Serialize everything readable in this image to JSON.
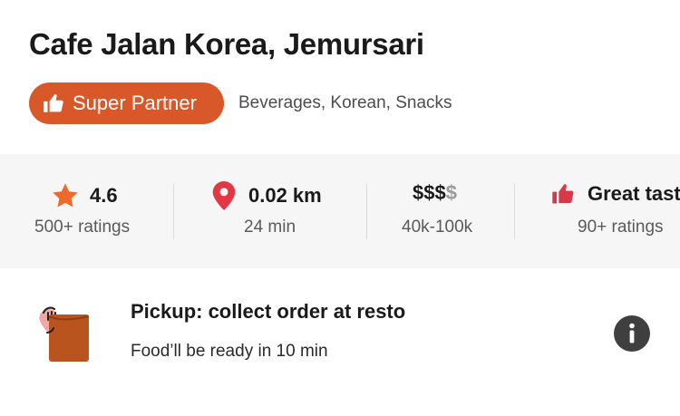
{
  "header": {
    "title": "Cafe Jalan Korea, Jemursari",
    "badge_label": "Super Partner",
    "cuisines": "Beverages, Korean, Snacks"
  },
  "stats": {
    "rating": {
      "value": "4.6",
      "caption": "500+ ratings",
      "icon": "star-icon"
    },
    "distance": {
      "value": "0.02 km",
      "caption": "24 min",
      "icon": "map-pin-icon"
    },
    "price": {
      "value_active": "$$$",
      "value_inactive": "$",
      "caption": "40k-100k"
    },
    "taste": {
      "value": "Great tast",
      "caption": "90+ ratings",
      "icon": "thumbs-up-icon"
    }
  },
  "pickup": {
    "title": "Pickup: collect order at resto",
    "subtitle": "Food’ll be ready in 10 min",
    "icon": "pickup-bag-icon",
    "info_icon": "info-icon"
  },
  "colors": {
    "accent": "#d9582a",
    "star": "#ef6a2a",
    "pin": "#e23744",
    "thumb_red": "#d93848",
    "stats_bg": "#f6f6f6"
  }
}
